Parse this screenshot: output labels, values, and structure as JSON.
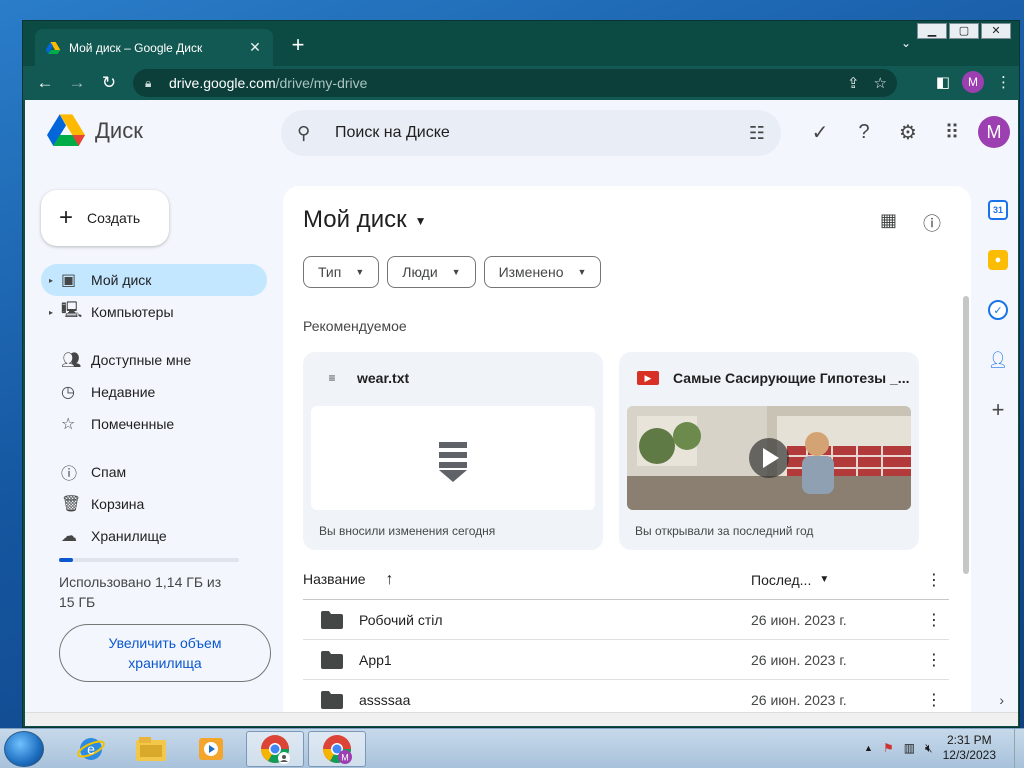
{
  "browser": {
    "tab_title": "Мой диск – Google Диск",
    "url_host": "drive.google.com",
    "url_path": "/drive/my-drive",
    "profile_initial": "M"
  },
  "app": {
    "name": "Диск",
    "search_placeholder": "Поиск на Диске",
    "avatar_initial": "M"
  },
  "sidebar": {
    "create_label": "Создать",
    "items": [
      {
        "label": "Мой диск",
        "icon": "drive-icon",
        "active": true
      },
      {
        "label": "Компьютеры",
        "icon": "computers-icon"
      },
      {
        "label": "Доступные мне",
        "icon": "shared-icon"
      },
      {
        "label": "Недавние",
        "icon": "clock-icon"
      },
      {
        "label": "Помеченные",
        "icon": "star-icon"
      },
      {
        "label": "Спам",
        "icon": "spam-icon"
      },
      {
        "label": "Корзина",
        "icon": "trash-icon"
      },
      {
        "label": "Хранилище",
        "icon": "cloud-icon"
      }
    ],
    "storage_text": "Использовано 1,14 ГБ из 15 ГБ",
    "storage_fraction": 0.076,
    "upgrade_label": "Увеличить объем хранилища"
  },
  "main": {
    "title": "Мой диск",
    "filters": [
      "Тип",
      "Люди",
      "Изменено"
    ],
    "section_label": "Рекомендуемое",
    "cards": [
      {
        "name": "wear.txt",
        "footer": "Вы вносили изменения сегодня",
        "icon": "text-file-icon"
      },
      {
        "name": "Самые Сасирующие Гипотезы _...",
        "footer": "Вы открывали за последний год",
        "icon": "video-file-icon"
      }
    ],
    "table": {
      "col_name": "Название",
      "col_modified": "Послед...",
      "rows": [
        {
          "name": "Робочий стіл",
          "date": "26 июн. 2023 г."
        },
        {
          "name": "App1",
          "date": "26 июн. 2023 г."
        },
        {
          "name": "assssaa",
          "date": "26 июн. 2023 г."
        }
      ]
    }
  },
  "taskbar": {
    "time": "2:31 PM",
    "date": "12/3/2023"
  },
  "colors": {
    "accent": "#0b57d0",
    "active_nav": "#c2e7ff",
    "browser_frame": "#135953",
    "avatar": "#9c3fb1"
  }
}
